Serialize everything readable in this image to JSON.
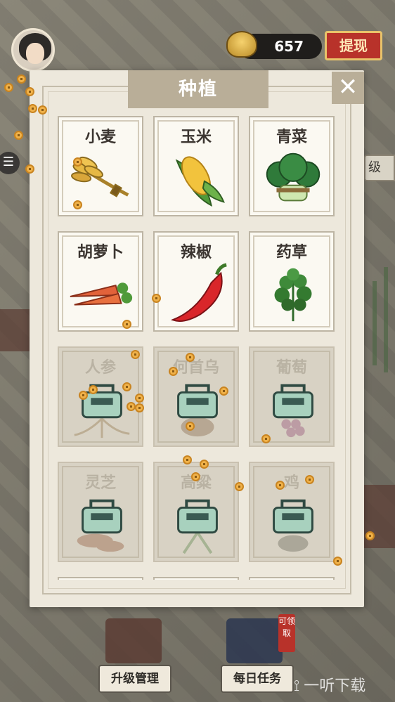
{
  "hud": {
    "coins": "657",
    "withdraw_label": "提现",
    "side_tab_label": "级"
  },
  "panel": {
    "title": "种植",
    "close_label": "✕"
  },
  "crops": [
    {
      "name": "小麦",
      "locked": false,
      "icon": "wheat-icon"
    },
    {
      "name": "玉米",
      "locked": false,
      "icon": "corn-icon"
    },
    {
      "name": "青菜",
      "locked": false,
      "icon": "greens-icon"
    },
    {
      "name": "胡萝卜",
      "locked": false,
      "icon": "carrot-icon"
    },
    {
      "name": "辣椒",
      "locked": false,
      "icon": "chili-icon"
    },
    {
      "name": "药草",
      "locked": false,
      "icon": "herb-icon"
    },
    {
      "name": "人参",
      "locked": true,
      "icon": "ginseng-icon"
    },
    {
      "name": "何首乌",
      "locked": true,
      "icon": "heshouwu-icon"
    },
    {
      "name": "葡萄",
      "locked": true,
      "icon": "grape-icon"
    },
    {
      "name": "灵芝",
      "locked": true,
      "icon": "lingzhi-icon"
    },
    {
      "name": "高粱",
      "locked": true,
      "icon": "sorghum-icon"
    },
    {
      "name": "鸡",
      "locked": true,
      "icon": "chicken-icon"
    }
  ],
  "bottom": {
    "upgrade_label": "升级管理",
    "daily_label": "每日任务",
    "claim_badge": "可领取",
    "watermark": "一听下载"
  },
  "colors": {
    "panel_bg": "#ede8dc",
    "title_bg": "#b9ae98",
    "card_bg": "#fbf9f2",
    "locked_bg": "#d8d2c4",
    "withdraw_red": "#b8322a",
    "coin_gold": "#f0b24a"
  }
}
